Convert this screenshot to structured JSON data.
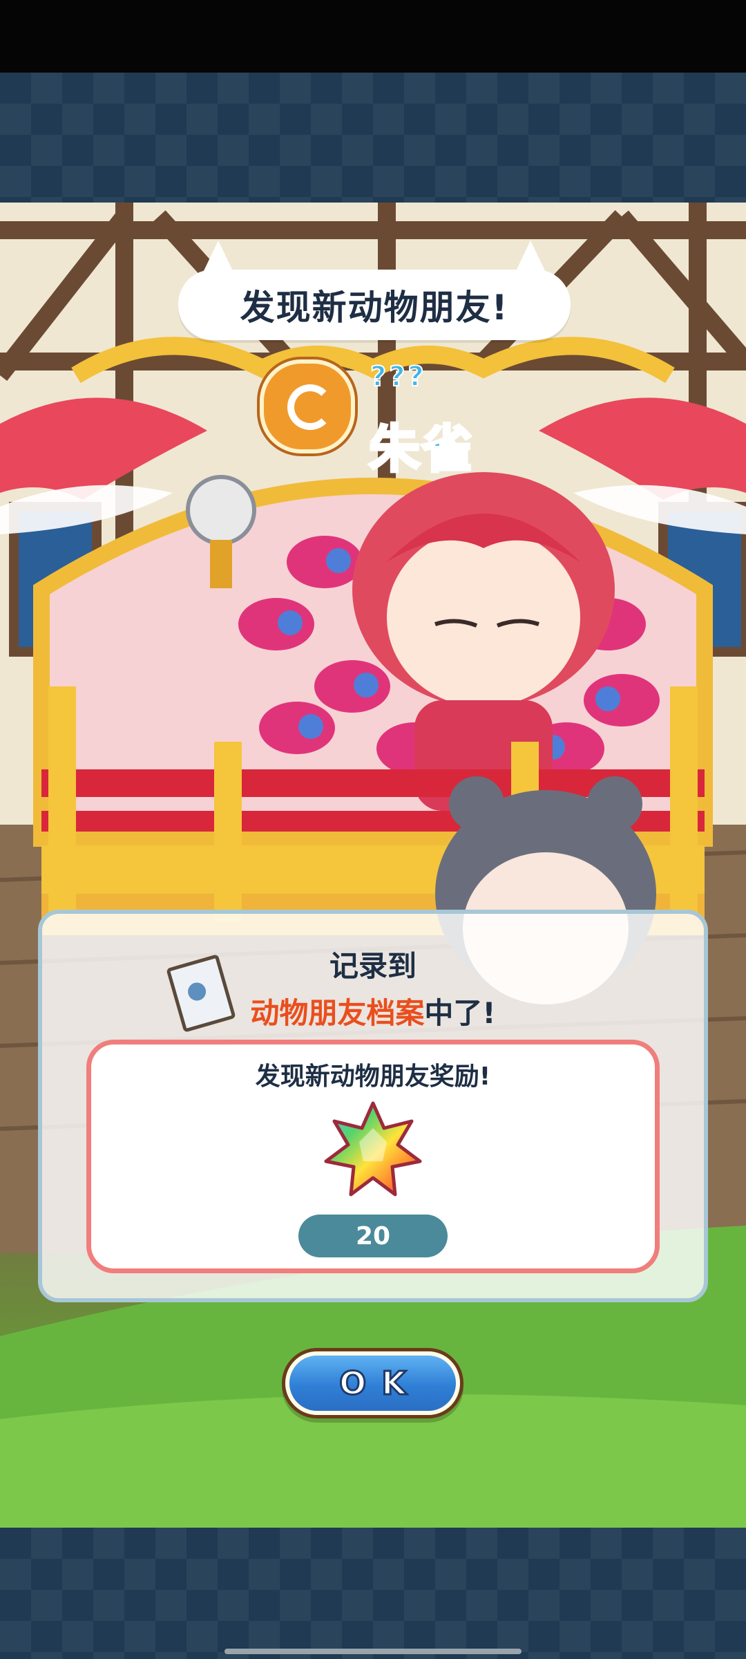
{
  "popup": {
    "title": "发现新动物朋友!",
    "rarity_hint": "???",
    "friend_name": "朱雀"
  },
  "dialog": {
    "line1": "记录到",
    "line2_highlight": "动物朋友档案",
    "line2_rest": "中了!",
    "reward_title": "发现新动物朋友奖励!",
    "reward_item_icon": "rainbow-crystal-icon",
    "reward_count": "20"
  },
  "ok_button": {
    "label": "OK"
  },
  "colors": {
    "frame": "#1f3a52",
    "name_text": "#3fb5ea",
    "highlight_text": "#ea4e1d",
    "reward_border": "#f07e7c",
    "count_pill": "#4a8a9a",
    "ok_button": "#2f7fd6"
  }
}
